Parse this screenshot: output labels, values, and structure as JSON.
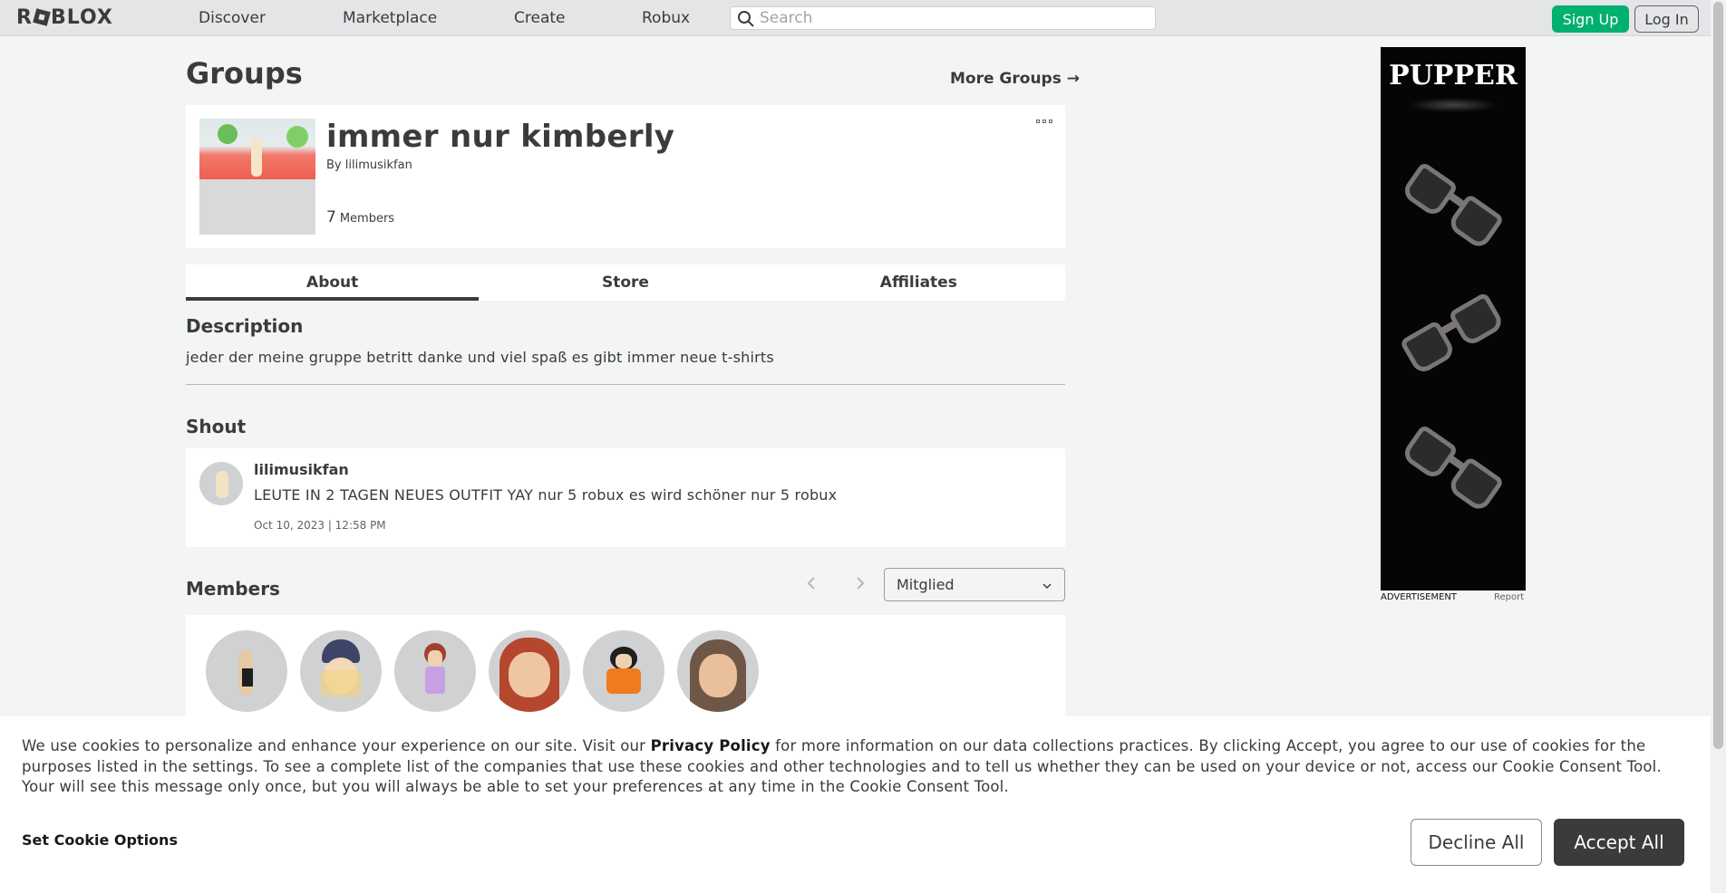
{
  "nav": {
    "logo": "ROBLOX",
    "links": [
      "Discover",
      "Marketplace",
      "Create",
      "Robux"
    ],
    "search_placeholder": "Search",
    "signup_label": "Sign Up",
    "login_label": "Log In"
  },
  "page": {
    "title": "Groups",
    "more_groups": "More Groups →"
  },
  "group": {
    "name": "immer nur kimberly",
    "by_prefix": "By",
    "owner": "lilimusikfan",
    "member_count": "7",
    "member_label": "Members"
  },
  "tabs": [
    {
      "label": "About",
      "active": true
    },
    {
      "label": "Store",
      "active": false
    },
    {
      "label": "Affiliates",
      "active": false
    }
  ],
  "description": {
    "heading": "Description",
    "text": "jeder der meine gruppe betritt danke und viel spaß es gibt immer neue t-shirts"
  },
  "shout": {
    "heading": "Shout",
    "user": "lilimusikfan",
    "body": "LEUTE IN 2 TAGEN NEUES OUTFIT YAY nur 5 robux es wird schöner nur 5 robux",
    "date": "Oct 10, 2023 | 12:58 PM"
  },
  "members": {
    "heading": "Members",
    "role_selected": "Mitglied",
    "avatar_count": 6
  },
  "ad": {
    "title": "PUPPER",
    "label": "ADVERTISEMENT",
    "report": "Report"
  },
  "cookie": {
    "text_before": "We use cookies to personalize and enhance your experience on our site. Visit our ",
    "privacy_link": "Privacy Policy",
    "text_after": " for more information on our data collections practices. By clicking Accept, you agree to our use of cookies for the purposes listed in the settings. To see a complete list of the companies that use these cookies and other technologies and to tell us whether they can be used on your device or not, access our Cookie Consent Tool. Your will see this message only once, but you will always be able to set your preferences at any time in the Cookie Consent Tool.",
    "set_options": "Set Cookie Options",
    "decline": "Decline All",
    "accept": "Accept All"
  },
  "colors": {
    "signup_green": "#00b06f",
    "dark_button": "#393b3d",
    "page_bg": "#f2f4f5"
  }
}
